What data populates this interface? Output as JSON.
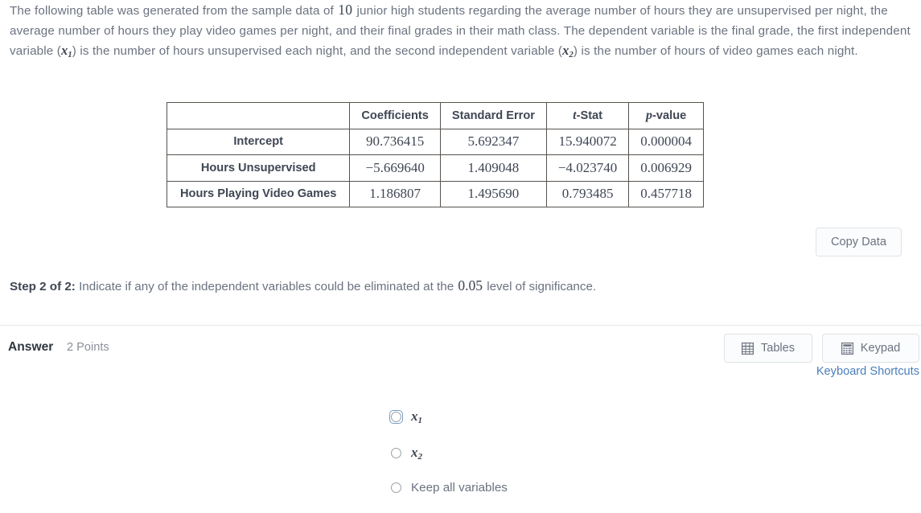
{
  "intro": {
    "part1": "The following table was generated from the sample data of ",
    "n": "10",
    "part2": " junior high students regarding the average number of hours they are unsupervised per night, the average number of hours they play video games per night, and their final grades in their math class. The dependent variable is the final grade, the first independent variable (",
    "var1": "x",
    "var1_sub": "1",
    "part3": ") is the number of hours unsupervised each night, and the second independent variable (",
    "var2": "x",
    "var2_sub": "2",
    "part4": ") is the number of hours of video games each night."
  },
  "table": {
    "corner_header": "",
    "headers": [
      {
        "italic": "",
        "rest": "Coefficients"
      },
      {
        "italic": "",
        "rest": "Standard Error"
      },
      {
        "italic": "t",
        "rest": "-Stat"
      },
      {
        "italic": "p",
        "rest": "-value"
      }
    ],
    "rows": [
      {
        "label": "Intercept",
        "coefficient": "90.736415",
        "standard_error": "5.692347",
        "t_stat": "15.940072",
        "p_value": "0.000004"
      },
      {
        "label": "Hours Unsupervised",
        "coefficient": "−5.669640",
        "standard_error": "1.409048",
        "t_stat": "−4.023740",
        "p_value": "0.006929"
      },
      {
        "label": "Hours Playing Video Games",
        "coefficient": "1.186807",
        "standard_error": "1.495690",
        "t_stat": "0.793485",
        "p_value": "0.457718"
      }
    ]
  },
  "copy_data": {
    "label": "Copy Data"
  },
  "step": {
    "label": "Step 2 of 2:",
    "text_before": " Indicate if any of the independent variables could be eliminated at the ",
    "alpha": "0.05",
    "text_after": " level of significance."
  },
  "answer": {
    "label": "Answer",
    "points": "2 Points",
    "tables_button": "Tables",
    "keypad_button": "Keypad",
    "keyboard_shortcuts": "Keyboard Shortcuts"
  },
  "options": [
    {
      "math": "x",
      "sub": "1",
      "text": "",
      "focused": true,
      "selected": false
    },
    {
      "math": "x",
      "sub": "2",
      "text": "",
      "focused": false,
      "selected": false
    },
    {
      "math": "",
      "sub": "",
      "text": "Keep all variables",
      "focused": false,
      "selected": false
    }
  ],
  "colors": {
    "link": "#4a7ebb",
    "focus_ring": "#74a0c4",
    "body_text": "#6b7280",
    "table_border": "#57534e"
  }
}
